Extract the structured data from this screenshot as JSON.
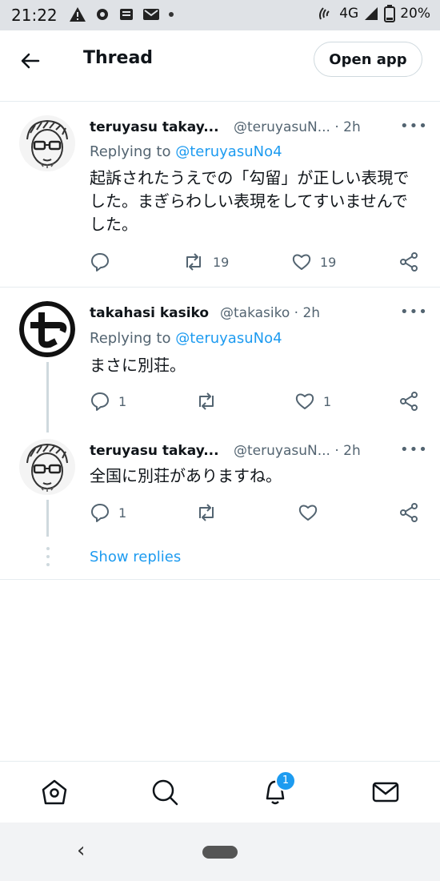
{
  "status_bar": {
    "time": "21:22",
    "network": "4G",
    "battery": "20%"
  },
  "header": {
    "title": "Thread",
    "open_app_label": "Open app"
  },
  "tweets": [
    {
      "name": "teruyasu takay...",
      "handle": "@teruyasuN... · 2h",
      "replying_prefix": "Replying to ",
      "replying_to": "@teruyasuNo4",
      "text": "起訴されたうえでの「勾留」が正しい表現でした。まぎらわしい表現をしてすいませんでした。",
      "retweets": "19",
      "likes": "19"
    },
    {
      "name": "takahasi kasiko",
      "handle": "@takasiko · 2h",
      "replying_prefix": "Replying to ",
      "replying_to": "@teruyasuNo4",
      "text": "まさに別荘。",
      "replies": "1",
      "likes": "1"
    },
    {
      "name": "teruyasu takay...",
      "handle": "@teruyasuN... · 2h",
      "text": "全国に別荘がありますね。",
      "replies": "1"
    }
  ],
  "show_replies_label": "Show replies",
  "bottom_nav": {
    "notification_count": "1",
    "items": [
      "home-icon",
      "search-icon",
      "notifications-icon",
      "messages-icon"
    ]
  },
  "colors": {
    "accent": "#1d9bf0",
    "text": "#0f1419",
    "secondary": "#536471"
  }
}
